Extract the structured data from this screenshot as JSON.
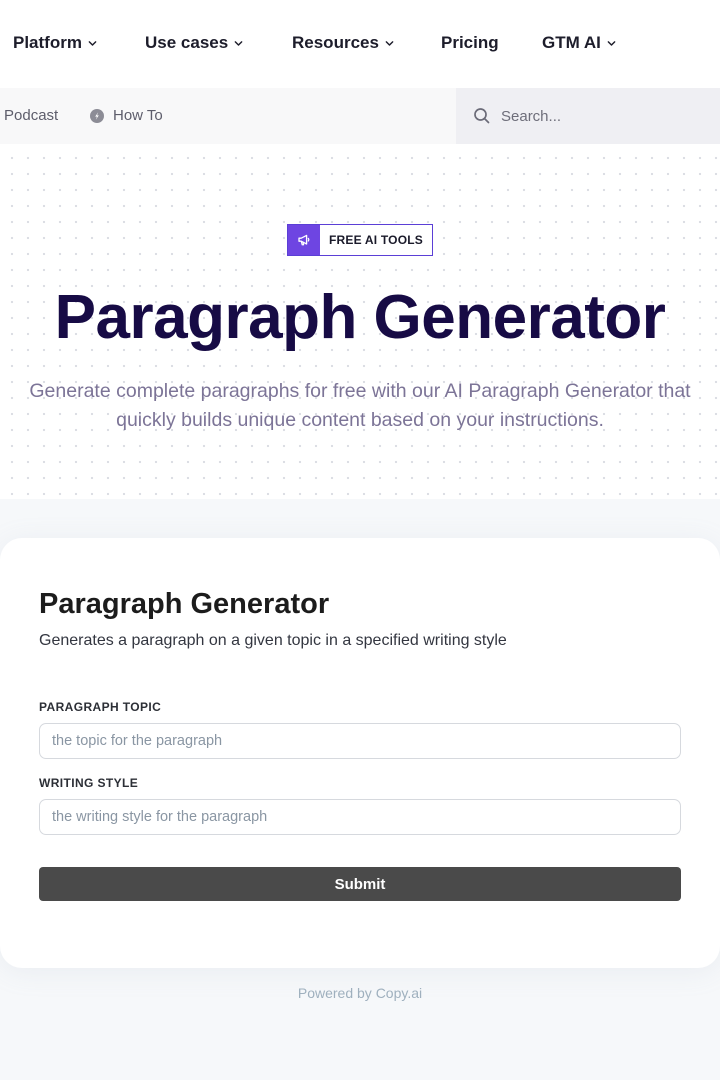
{
  "nav": {
    "items": [
      {
        "label": "Platform",
        "has_dropdown": true
      },
      {
        "label": "Use cases",
        "has_dropdown": true
      },
      {
        "label": "Resources",
        "has_dropdown": true
      },
      {
        "label": "Pricing",
        "has_dropdown": false
      },
      {
        "label": "GTM AI",
        "has_dropdown": true
      }
    ],
    "chevron_icon": "chevron-down-icon"
  },
  "subnav": {
    "links": [
      {
        "label": "Podcast"
      },
      {
        "label": "How To",
        "icon": "compass-icon"
      }
    ],
    "search": {
      "placeholder": "Search...",
      "icon": "search-icon"
    }
  },
  "hero": {
    "badge": {
      "label": "FREE AI TOOLS",
      "icon": "megaphone-icon",
      "accent": "#6e45e2"
    },
    "title": "Paragraph Generator",
    "subtitle": "Generate complete paragraphs for free with our AI Paragraph Generator that quickly builds unique content based on your instructions.",
    "title_color": "#170b45"
  },
  "tool": {
    "title": "Paragraph Generator",
    "description": "Generates a paragraph on a given topic in a specified writing style",
    "fields": [
      {
        "label": "PARAGRAPH TOPIC",
        "placeholder": "the topic for the paragraph",
        "value": ""
      },
      {
        "label": "WRITING STYLE",
        "placeholder": "the writing style for the paragraph",
        "value": ""
      }
    ],
    "submit_label": "Submit",
    "powered_by": "Powered by Copy.ai"
  }
}
